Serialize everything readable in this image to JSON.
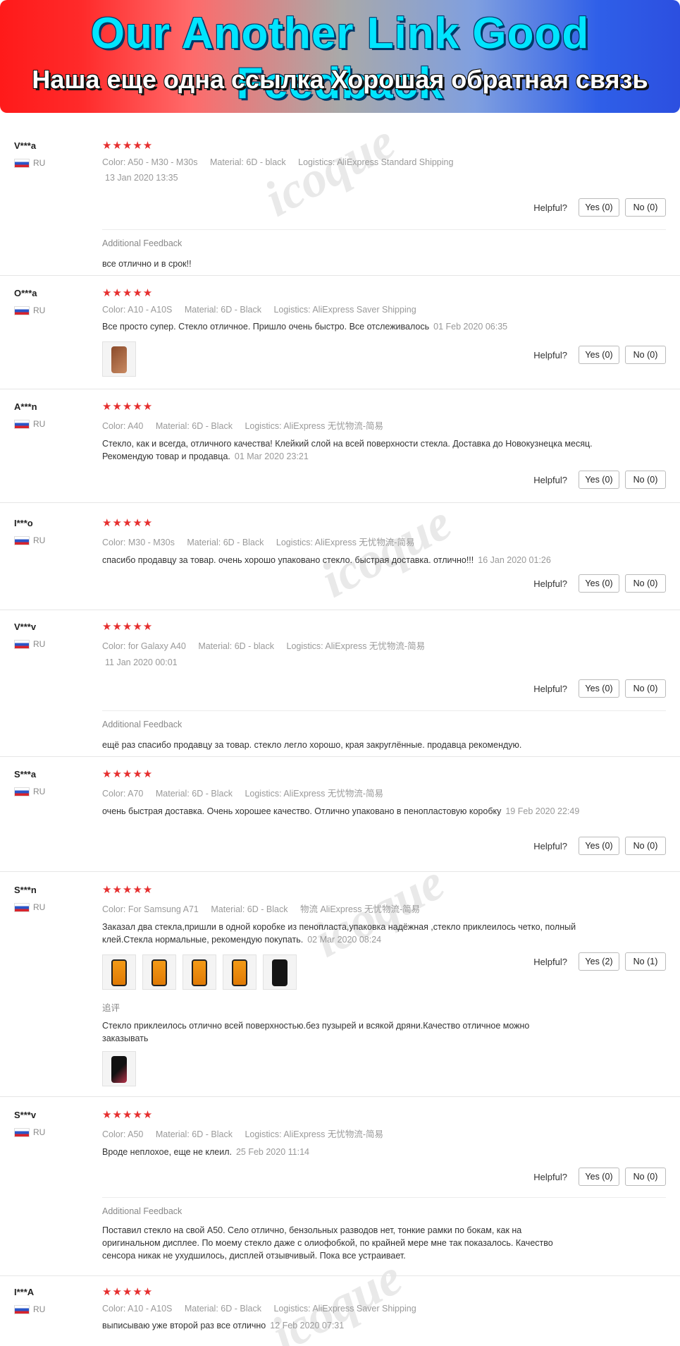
{
  "banner": {
    "title": "Our Another Link Good Feedback",
    "subtitle": "Наша еще одна ссылка Хорошая обратная связь"
  },
  "watermark": "icoque",
  "labels": {
    "color": "Color:",
    "material": "Material:",
    "logistics": "Logistics:",
    "helpful": "Helpful?",
    "additional_feedback": "Additional Feedback"
  },
  "reviews": [
    {
      "user": "V***a",
      "country": "RU",
      "stars": "★★★★★",
      "color": "A50 - M30 - M30s",
      "material": "6D - black",
      "logistics": "AliExpress Standard Shipping",
      "text": "",
      "date": "13 Jan 2020  13:35",
      "yes": "Yes (0)",
      "no": "No (0)",
      "additional_title": "Additional Feedback",
      "additional_text": "все отлично и в срок!!"
    },
    {
      "user": "O***a",
      "country": "RU",
      "stars": "★★★★★",
      "color": "A10 - A10S",
      "material": "6D - Black",
      "logistics": "AliExpress Saver Shipping",
      "text": "Все просто супер. Стекло отличное. Пришло очень быстро. Все отслеживалось",
      "date": "01 Feb 2020 06:35",
      "yes": "Yes (0)",
      "no": "No (0)"
    },
    {
      "user": "A***n",
      "country": "RU",
      "stars": "★★★★★",
      "color": "A40",
      "material": "6D - Black",
      "logistics": "AliExpress 无忧物流-简易",
      "text": "Стекло, как и всегда, отличного качества! Клейкий слой на всей поверхности стекла. Доставка до Новокузнецка месяц. Рекомендую товар и продавца.",
      "date": "01 Mar 2020 23:21",
      "yes": "Yes (0)",
      "no": "No (0)"
    },
    {
      "user": "I***o",
      "country": "RU",
      "stars": "★★★★★",
      "color": "M30 - M30s",
      "material": "6D - Black",
      "logistics": "AliExpress 无忧物流-简易",
      "text": "спасибо продавцу за товар. очень хорошо упаковано стекло. быстрая доставка. отлично!!!",
      "date": "16  Jan 2020  01:26",
      "yes": "Yes (0)",
      "no": "No (0)"
    },
    {
      "user": "V***v",
      "country": "RU",
      "stars": "★★★★★",
      "color": "for Galaxy A40",
      "material": "6D - black",
      "logistics": "AliExpress 无忧物流-简易",
      "text": "",
      "date": "11 Jan 2020 00:01",
      "yes": "Yes (0)",
      "no": "No (0)",
      "additional_title": "Additional Feedback",
      "additional_text": "ещё раз спасибо продавцу за товар. стекло легло хорошо, края закруглённые. продавца рекомендую."
    },
    {
      "user": "S***a",
      "country": "RU",
      "stars": "★★★★★",
      "color": "A70",
      "material": "6D - Black",
      "logistics": "AliExpress 无忧物流-简易",
      "text": "очень быстрая доставка. Очень хорошее качество. Отлично упаковано в пенопластовую коробку",
      "date": "19 Feb 2020 22:49",
      "yes": "Yes (0)",
      "no": "No (0)"
    },
    {
      "user": "S***n",
      "country": "RU",
      "stars": "★★★★★",
      "color": "For Samsung A71",
      "material": "6D - Black",
      "logistics_prefix": "物流",
      "logistics": "AliExpress 无忧物流-简易",
      "text": "Заказал два стекла,пришли в одной коробке из пенопласта,упаковка надёжная ,стекло приклеилось четко, полный клей.Стекла нормальные, рекомендую покупать.",
      "date": "02 Mar 2020 08:24",
      "yes": "Yes (2)",
      "no": "No (1)",
      "additional_title": "追评",
      "additional_text": "Стекло приклеилось отлично всей поверхностью.без пузырей и всякой дряни.Качество отличное можно заказывать"
    },
    {
      "user": "S***v",
      "country": "RU",
      "stars": "★★★★★",
      "color": "A50",
      "material": "6D - Black",
      "logistics": "AliExpress 无忧物流-简易",
      "text": "Вроде неплохое, еще не клеил.",
      "date": "25 Feb 2020 11:14",
      "yes": "Yes (0)",
      "no": "No (0)",
      "additional_title": "Additional Feedback",
      "additional_text": "Поставил стекло на свой А50. Село отлично, бензольных разводов нет, тонкие рамки по бокам, как на оригинальном дисплее. По моему стекло даже с олиофобкой, по крайней мере мне так показалось. Качество сенсора никак не ухудшилось, дисплей отзывчивый. Пока все устраивает."
    },
    {
      "user": "I***A",
      "country": "RU",
      "stars": "★★★★★",
      "color": "A10 - A10S",
      "material": "6D - Black",
      "logistics": "AliExpress Saver Shipping",
      "text": "выписываю уже второй раз все отлично",
      "date": "12 Feb 2020 07:31"
    }
  ]
}
